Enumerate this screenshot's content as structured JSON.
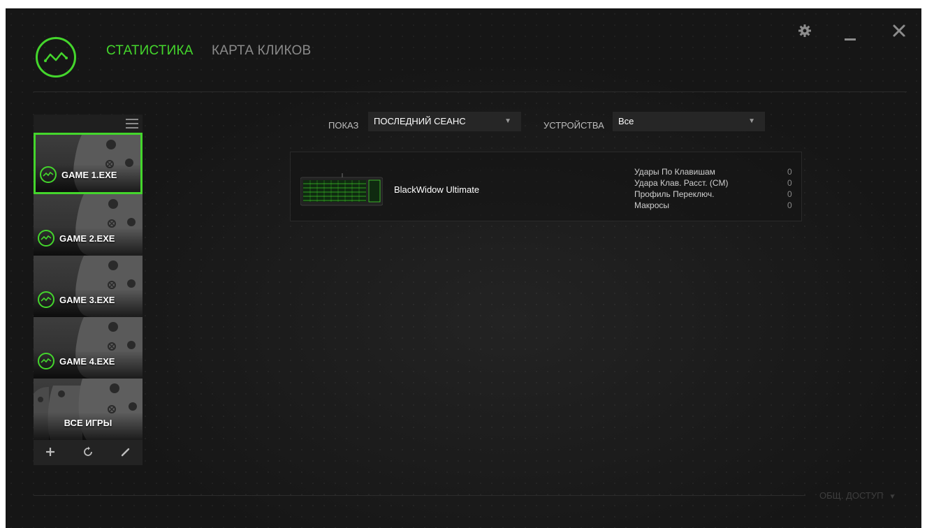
{
  "nav": {
    "tabs": [
      {
        "label": "СТАТИСТИКА",
        "active": true
      },
      {
        "label": "КАРТА КЛИКОВ",
        "active": false
      }
    ]
  },
  "window_controls": {
    "icons": [
      "gear-icon",
      "minimize-icon",
      "close-icon"
    ]
  },
  "filters": {
    "show_label": "ПОКАЗ",
    "show_value": "ПОСЛЕДНИЙ СЕАНС",
    "devices_label": "УСТРОЙСТВА",
    "devices_value": "Все"
  },
  "sidebar": {
    "games": [
      {
        "label": "GAME 1.EXE",
        "selected": true
      },
      {
        "label": "GAME 2.EXE",
        "selected": false
      },
      {
        "label": "GAME 3.EXE",
        "selected": false
      },
      {
        "label": "GAME 4.EXE",
        "selected": false
      }
    ],
    "all_games_label": "ВСЕ ИГРЫ",
    "footer_icons": [
      "add-icon",
      "refresh-icon",
      "edit-icon"
    ]
  },
  "device": {
    "name": "BlackWidow Ultimate",
    "stats": [
      {
        "label": "Удары По Клавишам",
        "value": "0"
      },
      {
        "label": "Удара Клав. Расст. (CM)",
        "value": "0"
      },
      {
        "label": "Профиль Переключ.",
        "value": "0"
      },
      {
        "label": "Макросы",
        "value": "0"
      }
    ]
  },
  "share_label": "ОБЩ. ДОСТУП",
  "colors": {
    "accent": "#44d62c",
    "background": "#161616"
  }
}
